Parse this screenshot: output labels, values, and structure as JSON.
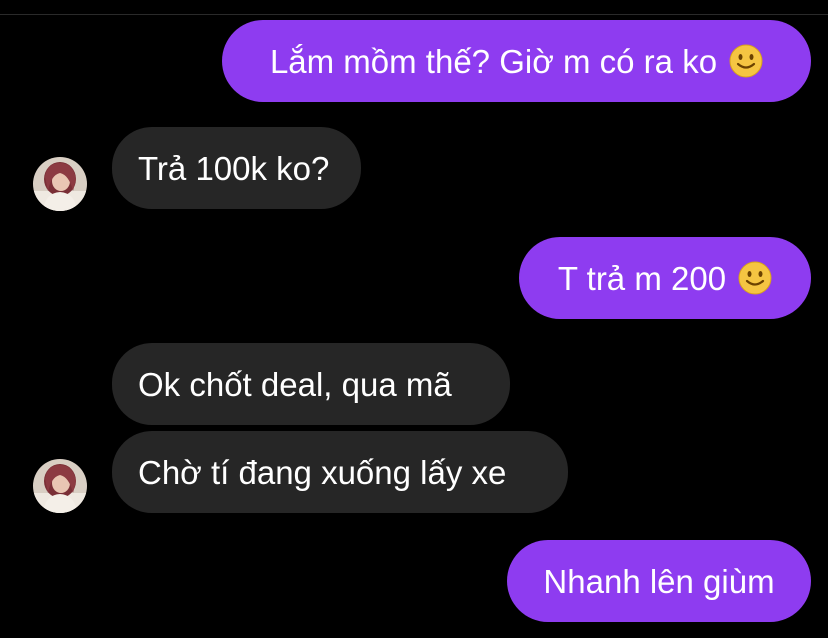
{
  "conversation": {
    "messages": [
      {
        "sender": "me",
        "text": "Lắm mồm thế? Giờ m có ra ko",
        "emoji": "slightly-smiling-face"
      },
      {
        "sender": "them",
        "text": "Trả 100k ko?"
      },
      {
        "sender": "me",
        "text": "T trả m 200",
        "emoji": "slightly-smiling-face"
      },
      {
        "sender": "them",
        "text": "Ok chốt deal, qua mã"
      },
      {
        "sender": "them",
        "text": "Chờ tí đang xuống lấy xe"
      },
      {
        "sender": "me",
        "text": "Nhanh lên giùm"
      }
    ]
  },
  "colors": {
    "background": "#000000",
    "sent_bubble": "#8e3cf0",
    "received_bubble": "#262626",
    "text": "#ffffff",
    "emoji": "#f5c542"
  },
  "icons": {
    "emoji": "slightly-smiling-face",
    "avatar": "contact-profile-photo"
  }
}
